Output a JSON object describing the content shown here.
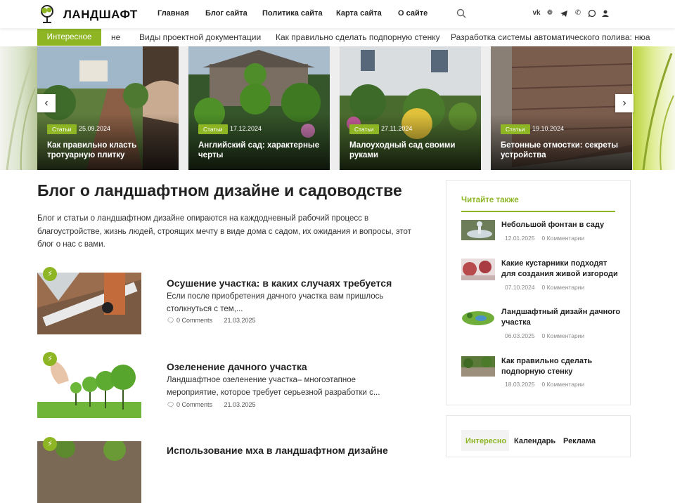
{
  "header": {
    "logo": "ЛАНДШАФТ",
    "nav": [
      "Главная",
      "Блог сайта",
      "Политика сайта",
      "Карта сайта",
      "О сайте"
    ],
    "social": [
      "vk-icon",
      "odnoklassniki-icon",
      "telegram-icon",
      "phone-icon",
      "whatsapp-icon",
      "user-icon"
    ]
  },
  "ticker": {
    "label": "Интересное",
    "items": [
      "не",
      "Виды проектной документации",
      "Как правильно сделать подпорную стенку",
      "Разработка системы автоматического полива: нюа"
    ]
  },
  "slider": {
    "slides": [
      {
        "category": "Статьи",
        "date": "25.09.2024",
        "title": "Как правильно класть тротуарную плитку"
      },
      {
        "category": "Статьи",
        "date": "17.12.2024",
        "title": "Английский сад: характерные черты"
      },
      {
        "category": "Статьи",
        "date": "27.11.2024",
        "title": "Малоуходный сад своими руками"
      },
      {
        "category": "Статьи",
        "date": "19.10.2024",
        "title": "Бетонные отмостки: секреты устройства"
      }
    ],
    "prev": "‹",
    "next": "›"
  },
  "main": {
    "title": "Блог о ландшафтном дизайне и садоводстве",
    "intro": "Блог и статьи о ландшафтном дизайне опираются на каждодневный рабочий процесс в благоустройстве, жизнь людей, строящих мечту в виде дома с садом, их ожидания и вопросы, этот блог о нас с вами.",
    "posts": [
      {
        "title": "Осушение участка: в каких случаях требуется",
        "excerpt": "Если после приобретения дачного участка вам пришлось столкнуться с тем,...",
        "comments": "0 Comments",
        "date": "21.03.2025"
      },
      {
        "title": "Озеленение дачного участка",
        "excerpt": "Ландшафтное озеленение участка– многоэтапное мероприятие, которое требует серьезной разработки с...",
        "comments": "0 Comments",
        "date": "21.03.2025"
      },
      {
        "title": "Использование мха в ландшафтном дизайне",
        "excerpt": "",
        "comments": "",
        "date": ""
      }
    ]
  },
  "sidebar": {
    "heading": "Читайте также",
    "related": [
      {
        "title": "Небольшой фонтан в саду",
        "date": "12.01.2025",
        "comments": "0 Комментарии"
      },
      {
        "title": "Какие кустарники подходят для создания живой изгороди",
        "date": "07.10.2024",
        "comments": "0 Комментарии"
      },
      {
        "title": "Ландшафтный дизайн дачного участка",
        "date": "06.03.2025",
        "comments": "0 Комментарии"
      },
      {
        "title": "Как правильно сделать подпорную стенку",
        "date": "18.03.2025",
        "comments": "0 Комментарии"
      }
    ],
    "tabs": [
      "Интересно",
      "Календарь",
      "Реклама"
    ]
  },
  "colors": {
    "accent": "#8db524",
    "text": "#222222"
  }
}
